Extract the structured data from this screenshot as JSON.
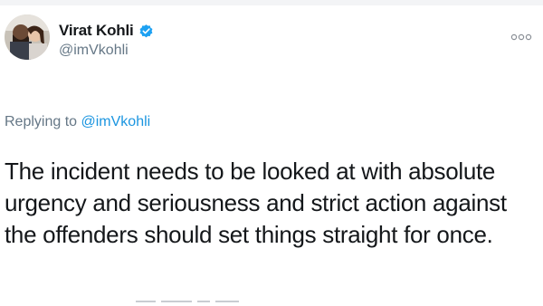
{
  "tweet": {
    "author": {
      "display_name": "Virat Kohli",
      "handle": "@imVkohli",
      "verified": true
    },
    "reply": {
      "prefix": "Replying to ",
      "handle": "@imVkohli"
    },
    "text": "The incident needs to be looked at with absolute urgency and seriousness and strict action against the offenders should set things straight for once."
  },
  "icons": {
    "verified": "verified-badge-icon",
    "more": "more-options-icon"
  },
  "colors": {
    "accent": "#1da1f2",
    "link": "#1b95e0",
    "text": "#14171a",
    "muted": "#657786"
  }
}
